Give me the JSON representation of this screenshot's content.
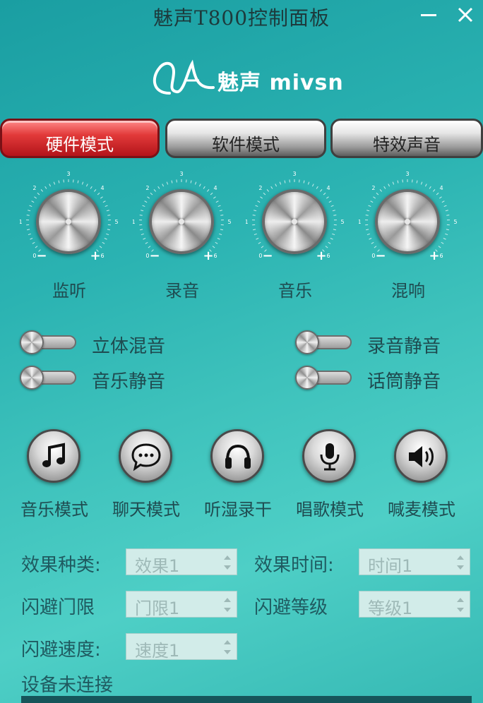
{
  "window": {
    "title": "魅声T800控制面板",
    "minimize_label": "",
    "close_label": ""
  },
  "logo": {
    "text": "魅声 mivsn"
  },
  "tabs": [
    {
      "label": "硬件模式",
      "active": true
    },
    {
      "label": "软件模式",
      "active": false
    },
    {
      "label": "特效声音",
      "active": false
    }
  ],
  "knobs": [
    {
      "label": "监听",
      "scale": [
        "0",
        "1",
        "2",
        "3",
        "4",
        "5",
        "6"
      ]
    },
    {
      "label": "录音",
      "scale": [
        "0",
        "1",
        "2",
        "3",
        "4",
        "5",
        "6"
      ]
    },
    {
      "label": "音乐",
      "scale": [
        "0",
        "1",
        "2",
        "3",
        "4",
        "5",
        "6"
      ]
    },
    {
      "label": "混响",
      "scale": [
        "0",
        "1",
        "2",
        "3",
        "4",
        "5",
        "6"
      ]
    }
  ],
  "knob_signs": {
    "minus": "−",
    "plus": "+"
  },
  "toggles": {
    "stereo_mix": "立体混音",
    "record_mute": "录音静音",
    "music_mute": "音乐静音",
    "mic_mute": "话筒静音"
  },
  "modes": [
    {
      "label": "音乐模式",
      "icon": "music-note-icon"
    },
    {
      "label": "聊天模式",
      "icon": "chat-bubble-icon"
    },
    {
      "label": "听湿录干",
      "icon": "headphones-icon"
    },
    {
      "label": "唱歌模式",
      "icon": "microphone-icon"
    },
    {
      "label": "喊麦模式",
      "icon": "speaker-icon"
    }
  ],
  "effects": {
    "type_label": "效果种类:",
    "type_value": "效果1",
    "time_label": "效果时间:",
    "time_value": "时间1",
    "gate_label": "闪避门限",
    "gate_value": "门限1",
    "level_label": "闪避等级",
    "level_value": "等级1",
    "speed_label": "闪避速度:",
    "speed_value": "速度1"
  },
  "status": "设备未连接",
  "colors": {
    "background": "#2bb3b2",
    "active_tab": "#e23a3a",
    "text_dark": "#1f4b50"
  }
}
